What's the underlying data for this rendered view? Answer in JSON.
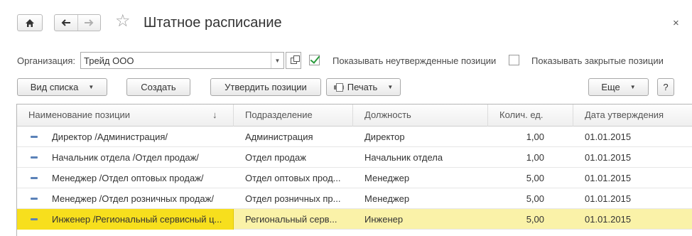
{
  "header": {
    "title": "Штатное расписание",
    "home_icon": "home-icon",
    "back_icon": "arrow-left-icon",
    "forward_icon": "arrow-right-icon",
    "favorite_icon": "star-icon",
    "close_label": "×"
  },
  "filters": {
    "org_label": "Организация:",
    "org_value": "Трейд ООО",
    "show_unapproved_label": "Показывать неутвержденные позиции",
    "show_unapproved_checked": true,
    "show_closed_label": "Показывать закрытые позиции",
    "show_closed_checked": false
  },
  "toolbar": {
    "view_list_label": "Вид списка",
    "create_label": "Создать",
    "approve_label": "Утвердить позиции",
    "print_label": "Печать",
    "more_label": "Еще",
    "help_label": "?"
  },
  "table": {
    "columns": [
      "Наименование позиции",
      "Подразделение",
      "Должность",
      "Колич. ед.",
      "Дата утверждения"
    ],
    "sort_indicator": "↓",
    "rows": [
      {
        "name": "Директор /Администрация/",
        "division": "Администрация",
        "position": "Директор",
        "qty": "1,00",
        "date": "01.01.2015",
        "selected": false
      },
      {
        "name": "Начальник отдела /Отдел продаж/",
        "division": "Отдел продаж",
        "position": "Начальник отдела",
        "qty": "1,00",
        "date": "01.01.2015",
        "selected": false
      },
      {
        "name": "Менеджер /Отдел оптовых продаж/",
        "division": "Отдел оптовых прод...",
        "position": "Менеджер",
        "qty": "5,00",
        "date": "01.01.2015",
        "selected": false
      },
      {
        "name": "Менеджер /Отдел розничных продаж/",
        "division": "Отдел розничных пр...",
        "position": "Менеджер",
        "qty": "5,00",
        "date": "01.01.2015",
        "selected": false
      },
      {
        "name": "Инженер /Региональный сервисный ц...",
        "division": "Региональный серв...",
        "position": "Инженер",
        "qty": "5,00",
        "date": "01.01.2015",
        "selected": true
      }
    ]
  },
  "colors": {
    "selected_row": "#faf2a8",
    "selected_cell": "#f7df1d",
    "checkbox_check": "#2a9b3c",
    "row_icon": "#5b82b8"
  }
}
